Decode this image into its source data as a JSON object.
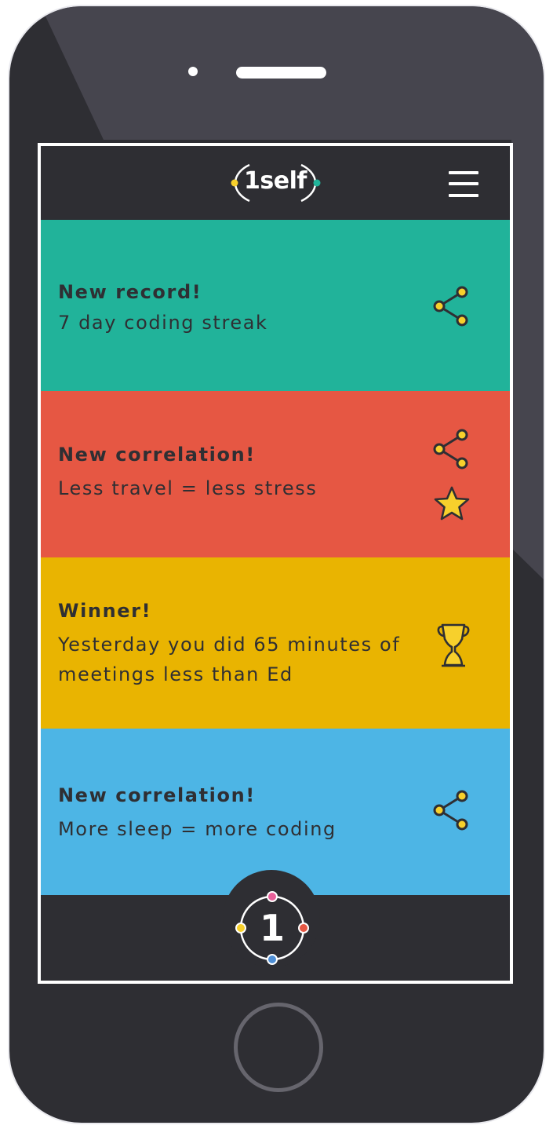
{
  "app": {
    "logo_text": "1self",
    "bottom_logo_text": "1"
  },
  "colors": {
    "teal": "#21b39a",
    "red": "#e65743",
    "yellow": "#e9b401",
    "blue": "#4db5e5",
    "dark": "#2e2e33",
    "icon_yellow": "#f7d02c"
  },
  "icons": {
    "menu": "hamburger-menu-icon",
    "share": "share-icon",
    "star": "star-icon",
    "trophy": "trophy-icon"
  },
  "cards": [
    {
      "title": "New record!",
      "body": "7 day coding streak",
      "color": "#21b39a",
      "actions": [
        "share"
      ]
    },
    {
      "title": "New correlation!",
      "body": "Less travel = less stress",
      "color": "#e65743",
      "actions": [
        "share",
        "star"
      ]
    },
    {
      "title": "Winner!",
      "body": "Yesterday you did 65 minutes of meetings less than Ed",
      "color": "#e9b401",
      "actions": [
        "trophy"
      ]
    },
    {
      "title": "New correlation!",
      "body": "More sleep = more coding",
      "color": "#4db5e5",
      "actions": [
        "share"
      ]
    }
  ]
}
